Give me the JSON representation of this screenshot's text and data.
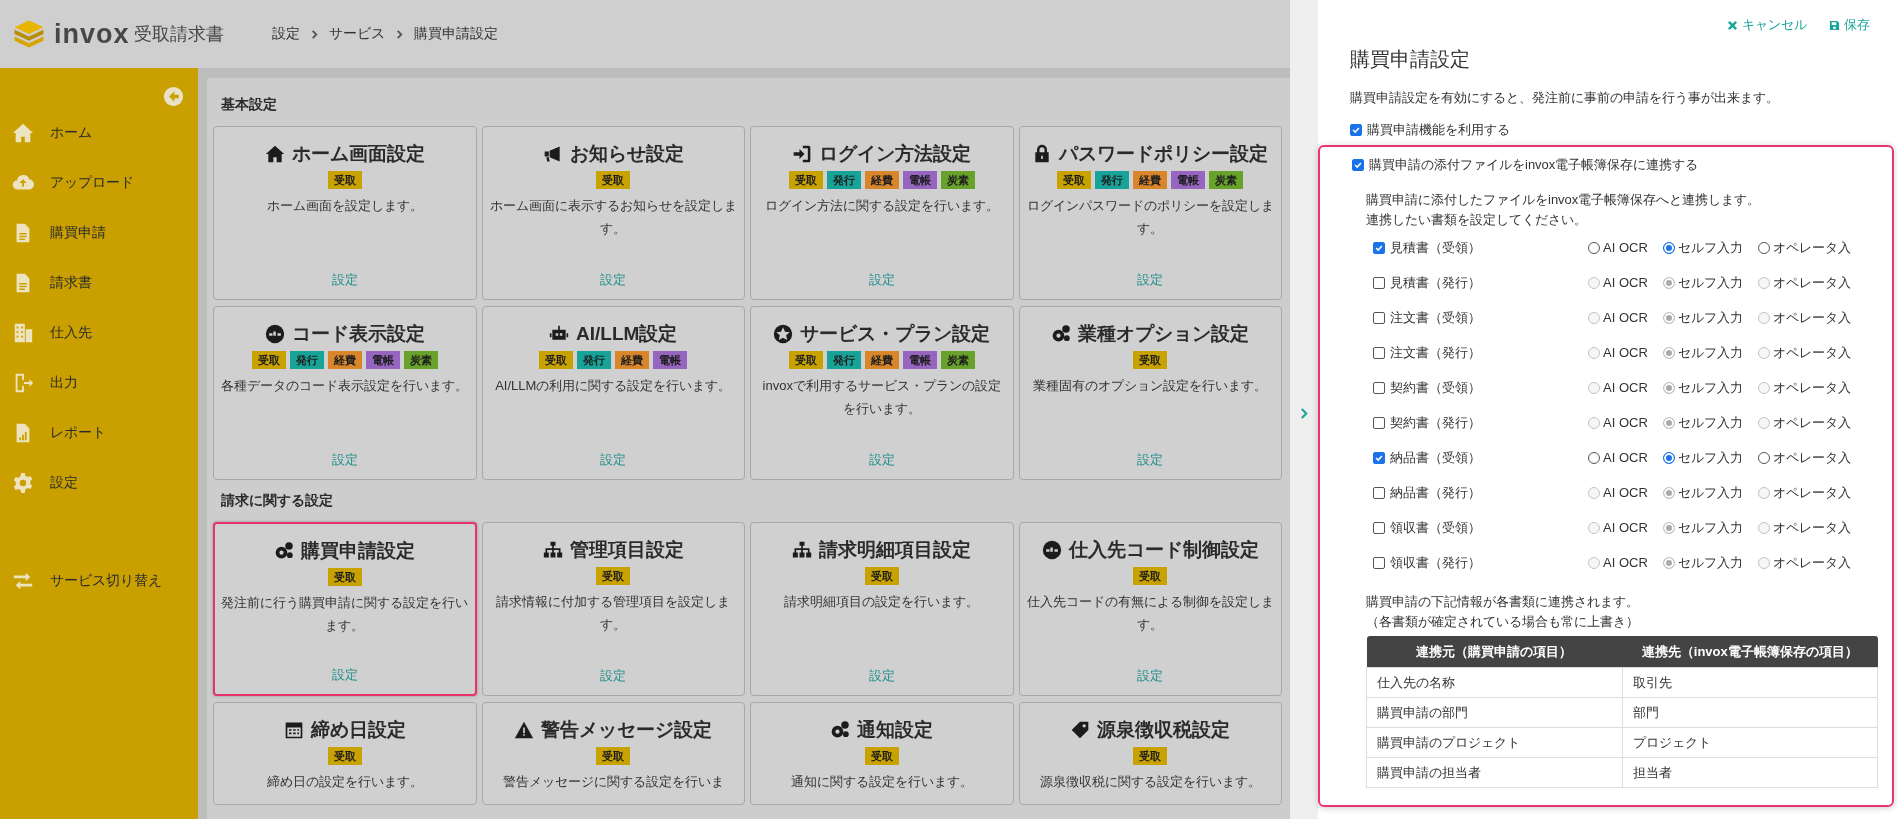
{
  "header": {
    "brand": "invox",
    "product": "受取請求書",
    "breadcrumbs": [
      "設定",
      "サービス",
      "購買申請設定"
    ]
  },
  "sidebar": {
    "items": [
      {
        "label": "ホーム"
      },
      {
        "label": "アップロード"
      },
      {
        "label": "購買申請"
      },
      {
        "label": "請求書"
      },
      {
        "label": "仕入先"
      },
      {
        "label": "出力"
      },
      {
        "label": "レポート"
      },
      {
        "label": "設定"
      }
    ],
    "footer_item": {
      "label": "サービス切り替え"
    }
  },
  "sections": [
    {
      "title": "基本設定",
      "cards": [
        {
          "title": "ホーム画面設定",
          "tags": [
            {
              "label": "受取",
              "color": "#c8a200"
            }
          ],
          "description": "ホーム画面を設定します。",
          "link": "設定",
          "selected": false
        },
        {
          "title": "お知らせ設定",
          "tags": [
            {
              "label": "受取",
              "color": "#c8a200"
            }
          ],
          "description": "ホーム画面に表示するお知らせを設定します。",
          "link": "設定",
          "selected": false
        },
        {
          "title": "ログイン方法設定",
          "tags": [
            {
              "label": "受取",
              "color": "#c8a200"
            },
            {
              "label": "発行",
              "color": "#17a398"
            },
            {
              "label": "経費",
              "color": "#d9862b"
            },
            {
              "label": "電帳",
              "color": "#9565bf"
            },
            {
              "label": "炭素",
              "color": "#69a22a"
            }
          ],
          "description": "ログイン方法に関する設定を行います。",
          "link": "設定",
          "selected": false
        },
        {
          "title": "パスワードポリシー設定",
          "tags": [
            {
              "label": "受取",
              "color": "#c8a200"
            },
            {
              "label": "発行",
              "color": "#17a398"
            },
            {
              "label": "経費",
              "color": "#d9862b"
            },
            {
              "label": "電帳",
              "color": "#9565bf"
            },
            {
              "label": "炭素",
              "color": "#69a22a"
            }
          ],
          "description": "ログインパスワードのポリシーを設定します。",
          "link": "設定",
          "selected": false
        },
        {
          "title": "コード表示設定",
          "tags": [
            {
              "label": "受取",
              "color": "#c8a200"
            },
            {
              "label": "発行",
              "color": "#17a398"
            },
            {
              "label": "経費",
              "color": "#d9862b"
            },
            {
              "label": "電帳",
              "color": "#9565bf"
            },
            {
              "label": "炭素",
              "color": "#69a22a"
            }
          ],
          "description": "各種データのコード表示設定を行います。",
          "link": "設定",
          "selected": false
        },
        {
          "title": "AI/LLM設定",
          "tags": [
            {
              "label": "受取",
              "color": "#c8a200"
            },
            {
              "label": "発行",
              "color": "#17a398"
            },
            {
              "label": "経費",
              "color": "#d9862b"
            },
            {
              "label": "電帳",
              "color": "#9565bf"
            }
          ],
          "description": "AI/LLMの利用に関する設定を行います。",
          "link": "設定",
          "selected": false
        },
        {
          "title": "サービス・プラン設定",
          "tags": [
            {
              "label": "受取",
              "color": "#c8a200"
            },
            {
              "label": "発行",
              "color": "#17a398"
            },
            {
              "label": "経費",
              "color": "#d9862b"
            },
            {
              "label": "電帳",
              "color": "#9565bf"
            },
            {
              "label": "炭素",
              "color": "#69a22a"
            }
          ],
          "description": "invoxで利用するサービス・プランの設定を行います。",
          "link": "設定",
          "selected": false
        },
        {
          "title": "業種オプション設定",
          "tags": [
            {
              "label": "受取",
              "color": "#c8a200"
            }
          ],
          "description": "業種固有のオプション設定を行います。",
          "link": "設定",
          "selected": false
        }
      ]
    },
    {
      "title": "請求に関する設定",
      "cards": [
        {
          "title": "購買申請設定",
          "tags": [
            {
              "label": "受取",
              "color": "#c8a200"
            }
          ],
          "description": "発注前に行う購買申請に関する設定を行います。",
          "link": "設定",
          "selected": true
        },
        {
          "title": "管理項目設定",
          "tags": [
            {
              "label": "受取",
              "color": "#c8a200"
            }
          ],
          "description": "請求情報に付加する管理項目を設定します。",
          "link": "設定",
          "selected": false
        },
        {
          "title": "請求明細項目設定",
          "tags": [
            {
              "label": "受取",
              "color": "#c8a200"
            }
          ],
          "description": "請求明細項目の設定を行います。",
          "link": "設定",
          "selected": false
        },
        {
          "title": "仕入先コード制御設定",
          "tags": [
            {
              "label": "受取",
              "color": "#c8a200"
            }
          ],
          "description": "仕入先コードの有無による制御を設定します。",
          "link": "設定",
          "selected": false
        },
        {
          "title": "締め日設定",
          "tags": [
            {
              "label": "受取",
              "color": "#c8a200"
            }
          ],
          "description": "締め日の設定を行います。",
          "selected": false
        },
        {
          "title": "警告メッセージ設定",
          "tags": [
            {
              "label": "受取",
              "color": "#c8a200"
            }
          ],
          "description": "警告メッセージに関する設定を行いま",
          "selected": false
        },
        {
          "title": "通知設定",
          "tags": [
            {
              "label": "受取",
              "color": "#c8a200"
            }
          ],
          "description": "通知に関する設定を行います。",
          "selected": false
        },
        {
          "title": "源泉徴収税設定",
          "tags": [
            {
              "label": "受取",
              "color": "#c8a200"
            }
          ],
          "description": "源泉徴収税に関する設定を行います。",
          "selected": false
        }
      ]
    }
  ],
  "panel": {
    "cancel": "キャンセル",
    "save": "保存",
    "title": "購買申請設定",
    "description": "購買申請設定を有効にすると、発注前に事前の申請を行う事が出来ます。",
    "enable": {
      "label": "購買申請機能を利用する",
      "checked": true
    },
    "link_box": {
      "label": "購買申請の添付ファイルをinvox電子帳簿保存に連携する",
      "checked": true,
      "description_lines": [
        "購買申請に添付したファイルをinvox電子帳簿保存へと連携します。",
        "連携したい書類を設定してください。"
      ],
      "documents": [
        {
          "label": "見積書（受領）",
          "checked": true,
          "options": [
            {
              "label": "AI OCR",
              "selected": false
            },
            {
              "label": "セルフ入力",
              "selected": true
            },
            {
              "label": "オペレータ入",
              "selected": false
            }
          ]
        },
        {
          "label": "見積書（発行）",
          "checked": false,
          "options": [
            {
              "label": "AI OCR",
              "selected": false
            },
            {
              "label": "セルフ入力",
              "selected": true
            },
            {
              "label": "オペレータ入",
              "selected": false
            }
          ]
        },
        {
          "label": "注文書（受領）",
          "checked": false,
          "options": [
            {
              "label": "AI OCR",
              "selected": false
            },
            {
              "label": "セルフ入力",
              "selected": true
            },
            {
              "label": "オペレータ入",
              "selected": false
            }
          ]
        },
        {
          "label": "注文書（発行）",
          "checked": false,
          "options": [
            {
              "label": "AI OCR",
              "selected": false
            },
            {
              "label": "セルフ入力",
              "selected": true
            },
            {
              "label": "オペレータ入",
              "selected": false
            }
          ]
        },
        {
          "label": "契約書（受領）",
          "checked": false,
          "options": [
            {
              "label": "AI OCR",
              "selected": false
            },
            {
              "label": "セルフ入力",
              "selected": true
            },
            {
              "label": "オペレータ入",
              "selected": false
            }
          ]
        },
        {
          "label": "契約書（発行）",
          "checked": false,
          "options": [
            {
              "label": "AI OCR",
              "selected": false
            },
            {
              "label": "セルフ入力",
              "selected": true
            },
            {
              "label": "オペレータ入",
              "selected": false
            }
          ]
        },
        {
          "label": "納品書（受領）",
          "checked": true,
          "options": [
            {
              "label": "AI OCR",
              "selected": false
            },
            {
              "label": "セルフ入力",
              "selected": true
            },
            {
              "label": "オペレータ入",
              "selected": false
            }
          ]
        },
        {
          "label": "納品書（発行）",
          "checked": false,
          "options": [
            {
              "label": "AI OCR",
              "selected": false
            },
            {
              "label": "セルフ入力",
              "selected": true
            },
            {
              "label": "オペレータ入",
              "selected": false
            }
          ]
        },
        {
          "label": "領収書（受領）",
          "checked": false,
          "options": [
            {
              "label": "AI OCR",
              "selected": false
            },
            {
              "label": "セルフ入力",
              "selected": true
            },
            {
              "label": "オペレータ入",
              "selected": false
            }
          ]
        },
        {
          "label": "領収書（発行）",
          "checked": false,
          "options": [
            {
              "label": "AI OCR",
              "selected": false
            },
            {
              "label": "セルフ入力",
              "selected": true
            },
            {
              "label": "オペレータ入",
              "selected": false
            }
          ]
        }
      ],
      "note_lines": [
        "購買申請の下記情報が各書類に連携されます。",
        "（各書類が確定されている場合も常に上書き）"
      ],
      "table": {
        "columns": [
          "連携元（購買申請の項目）",
          "連携先（invox電子帳簿保存の項目）"
        ],
        "rows": [
          [
            "仕入先の名称",
            "取引先"
          ],
          [
            "購買申請の部門",
            "部門"
          ],
          [
            "購買申請のプロジェクト",
            "プロジェクト"
          ],
          [
            "購買申請の担当者",
            "担当者"
          ]
        ]
      }
    }
  }
}
